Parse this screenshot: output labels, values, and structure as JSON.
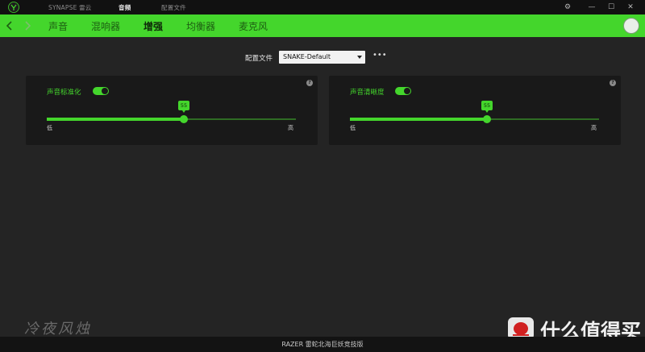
{
  "title_bar": {
    "tabs": [
      {
        "label": "SYNAPSE 雷云"
      },
      {
        "label": "音频"
      },
      {
        "label": "配置文件"
      }
    ],
    "window_controls": {
      "settings_icon": "gear-icon",
      "minimize_icon": "minimize-icon",
      "maximize_icon": "maximize-icon",
      "close_icon": "close-icon",
      "minimize_glyph": "—",
      "maximize_glyph": "☐",
      "close_glyph": "✕",
      "settings_glyph": "⚙"
    }
  },
  "nav": {
    "tabs": [
      {
        "label": "声音"
      },
      {
        "label": "混响器"
      },
      {
        "label": "增强"
      },
      {
        "label": "均衡器"
      },
      {
        "label": "麦克风"
      }
    ],
    "active_tab": "增强"
  },
  "profile": {
    "label": "配置文件",
    "selected": "SNAKE-Default",
    "more": "•••"
  },
  "cards": [
    {
      "title": "声音标准化",
      "enabled": true,
      "value": 55,
      "value_label": "55",
      "low": "低",
      "high": "高",
      "help": "?"
    },
    {
      "title": "声音清晰度",
      "enabled": true,
      "value": 55,
      "value_label": "55",
      "low": "低",
      "high": "高",
      "help": "?"
    }
  ],
  "footer": {
    "device": "RAZER 雷蛇北海巨妖竞技版"
  },
  "watermarks": {
    "left": "冷夜风烛",
    "right": "什么值得买"
  },
  "colors": {
    "accent": "#44d62c",
    "background": "#242424",
    "card": "#191919",
    "titlebar": "#111111"
  }
}
